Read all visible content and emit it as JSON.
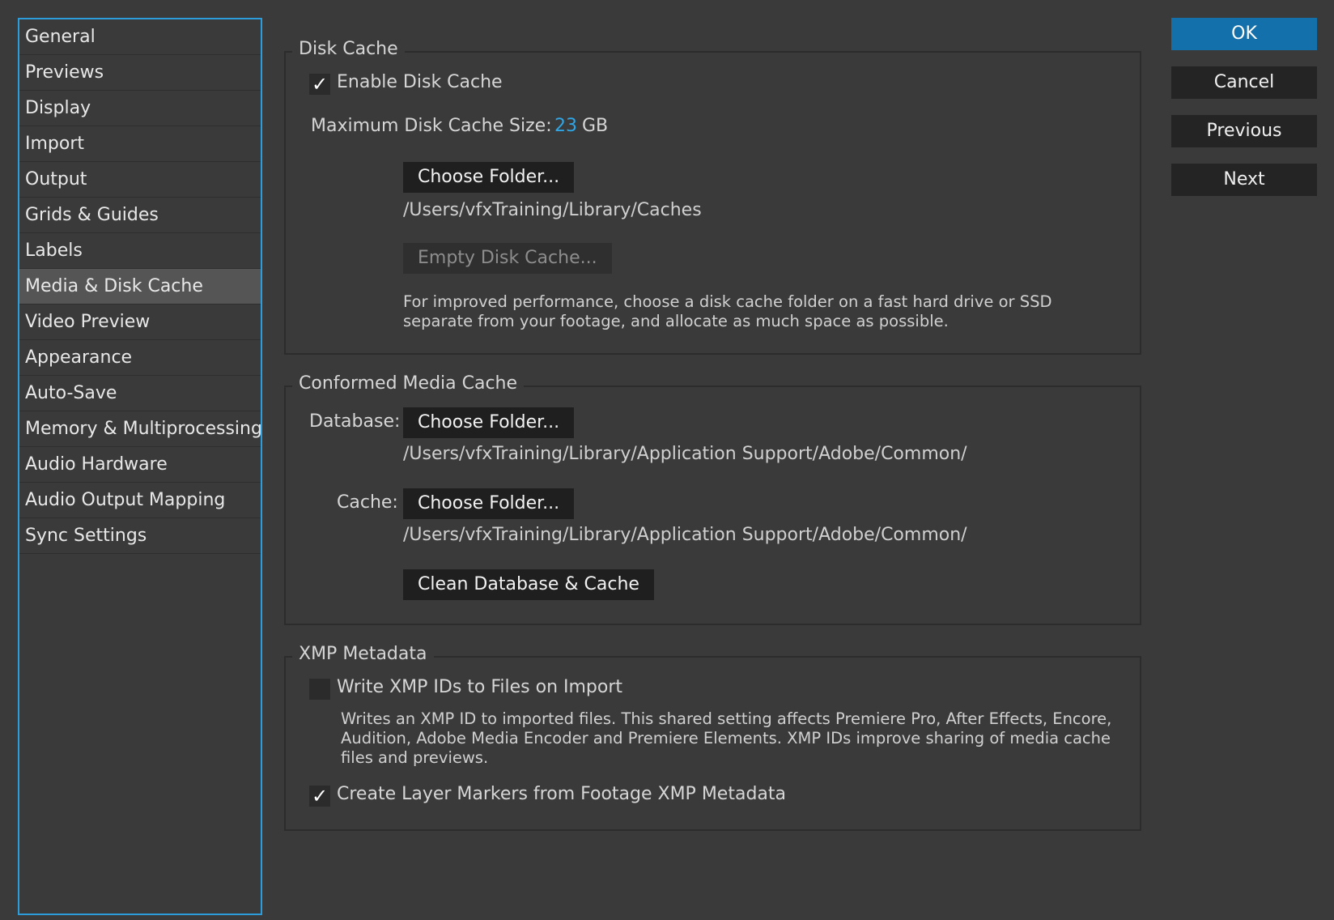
{
  "sidebar": {
    "items": [
      {
        "label": "General"
      },
      {
        "label": "Previews"
      },
      {
        "label": "Display"
      },
      {
        "label": "Import"
      },
      {
        "label": "Output"
      },
      {
        "label": "Grids & Guides"
      },
      {
        "label": "Labels"
      },
      {
        "label": "Media & Disk Cache",
        "selected": true
      },
      {
        "label": "Video Preview"
      },
      {
        "label": "Appearance"
      },
      {
        "label": "Auto-Save"
      },
      {
        "label": "Memory & Multiprocessing"
      },
      {
        "label": "Audio Hardware"
      },
      {
        "label": "Audio Output Mapping"
      },
      {
        "label": "Sync Settings"
      }
    ]
  },
  "disk_cache": {
    "title": "Disk Cache",
    "enable_label": "Enable Disk Cache",
    "enable_checked": true,
    "max_size_label": "Maximum Disk Cache Size:",
    "max_size_value": "23",
    "max_size_unit": "GB",
    "choose_folder_label": "Choose Folder...",
    "folder_path": "/Users/vfxTraining/Library/Caches",
    "empty_label": "Empty Disk Cache...",
    "description": "For improved performance, choose a disk cache folder on a fast hard drive or SSD separate from your footage, and allocate as much space as possible."
  },
  "conformed": {
    "title": "Conformed Media Cache",
    "database_label": "Database:",
    "database_button": "Choose Folder...",
    "database_path": "/Users/vfxTraining/Library/Application Support/Adobe/Common/",
    "cache_label": "Cache:",
    "cache_button": "Choose Folder...",
    "cache_path": "/Users/vfxTraining/Library/Application Support/Adobe/Common/",
    "clean_label": "Clean Database & Cache"
  },
  "xmp": {
    "title": "XMP Metadata",
    "write_label": "Write XMP IDs to Files on Import",
    "write_checked": false,
    "write_description": "Writes an XMP ID to imported files. This shared setting affects Premiere Pro, After Effects, Encore, Audition, Adobe Media Encoder and Premiere Elements. XMP IDs improve sharing of media cache files and previews.",
    "markers_label": "Create Layer Markers from Footage XMP Metadata",
    "markers_checked": true
  },
  "dialog_buttons": {
    "ok": "OK",
    "cancel": "Cancel",
    "previous": "Previous",
    "next": "Next"
  },
  "colors": {
    "accent": "#2fa6e6",
    "primary_button": "#1470aa",
    "background": "#3a3a3a",
    "sidebar_border": "#2d9cdb",
    "selected_item": "#555555"
  },
  "icons": {
    "checkmark": "checkmark-icon"
  }
}
